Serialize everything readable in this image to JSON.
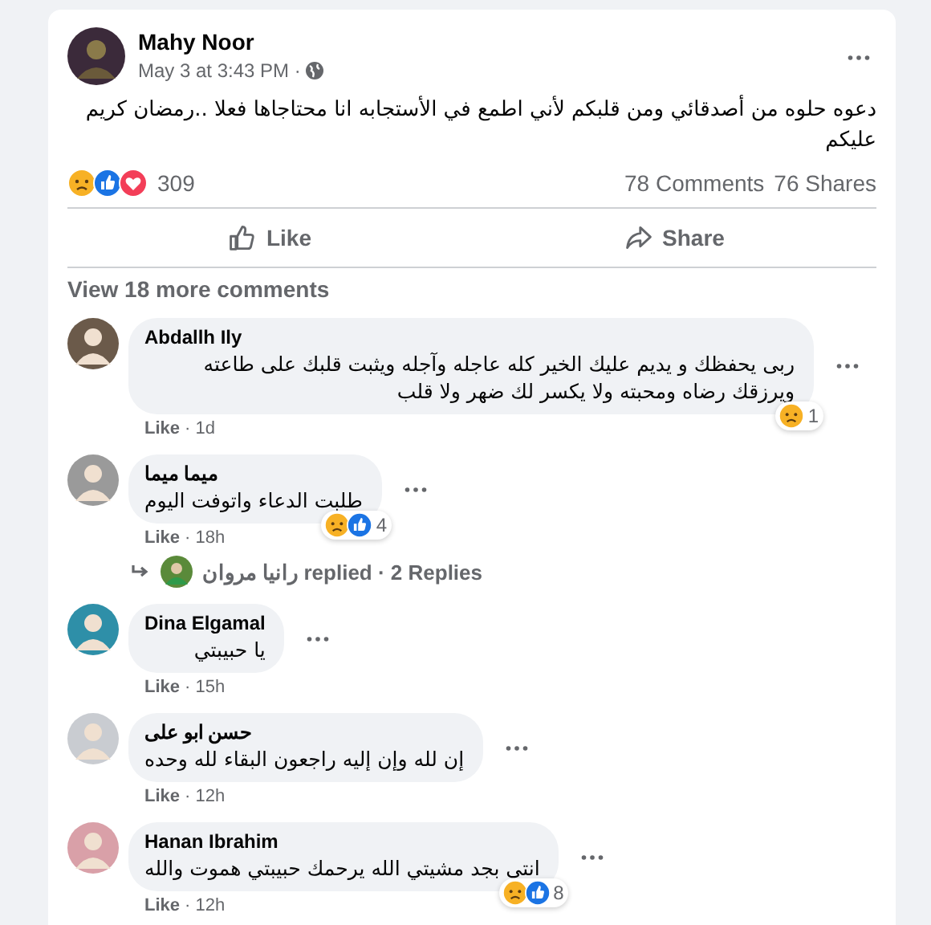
{
  "post": {
    "author": "Mahy Noor",
    "timestamp": "May 3 at 3:43 PM ·",
    "text": "دعوه حلوه من أصدقائي ومن قلبكم لأني اطمع في الأستجابه انا محتاجاها فعلا ..رمضان كريم عليكم",
    "reactions": [
      {
        "kind": "sad"
      },
      {
        "kind": "like"
      },
      {
        "kind": "love"
      }
    ],
    "reaction_count": "309",
    "comments_count": "78 Comments",
    "shares_count": "76 Shares"
  },
  "like_action": {
    "label": "Like"
  },
  "share_action": {
    "label": "Share"
  },
  "view_more": "View 18 more comments",
  "comments": [
    {
      "author": "Abdallh Ily",
      "text": "ربى يحفظك و يديم عليك الخير كله عاجله وآجله ويثبت قلبك على طاعته ويرزقك رضاه ومحبته ولا يكسر لك ضهر ولا قلب",
      "like": "Like",
      "time": "· 1d",
      "reactions": [
        {
          "kind": "sad"
        }
      ],
      "reaction_count": "1"
    },
    {
      "author": "ميما ميما",
      "text": "طلبت الدعاء واتوفت اليوم",
      "like": "Like",
      "time": "· 18h",
      "reactions": [
        {
          "kind": "sad"
        },
        {
          "kind": "like"
        }
      ],
      "reaction_count": "4",
      "reply_summary": {
        "replier": "رانيا مروان",
        "label": "replied · 2 Replies"
      }
    },
    {
      "author": "Dina Elgamal",
      "text": "يا حبيبتي",
      "like": "Like",
      "time": "· 15h"
    },
    {
      "author": "حسن ابو على",
      "text": "إن لله وإن إليه راجعون البقاء لله وحده",
      "like": "Like",
      "time": "· 12h"
    },
    {
      "author": "Hanan Ibrahim",
      "text": "انتى بجد مشيتي الله يرحمك حبيبتي هموت والله",
      "like": "Like",
      "time": "· 12h",
      "reactions": [
        {
          "kind": "sad"
        },
        {
          "kind": "like"
        }
      ],
      "reaction_count": "8"
    }
  ]
}
